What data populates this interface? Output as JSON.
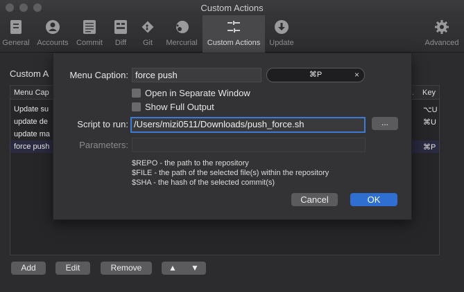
{
  "window": {
    "title": "Custom Actions"
  },
  "toolbar": {
    "items": [
      {
        "label": "General"
      },
      {
        "label": "Accounts"
      },
      {
        "label": "Commit"
      },
      {
        "label": "Diff"
      },
      {
        "label": "Git"
      },
      {
        "label": "Mercurial"
      },
      {
        "label": "Custom Actions"
      },
      {
        "label": "Update"
      },
      {
        "label": "Advanced"
      }
    ]
  },
  "main": {
    "section_title": "Custom A",
    "table": {
      "col_caption": "Menu Cap",
      "col_dots": "..",
      "col_key": "Key",
      "rows": [
        {
          "caption": "Update su",
          "key": "⌥U"
        },
        {
          "caption": "update de",
          "key": "⌘U"
        },
        {
          "caption": "update ma",
          "key": ""
        },
        {
          "caption": "force push",
          "key": "⌘P"
        }
      ]
    },
    "buttons": {
      "add": "Add",
      "edit": "Edit",
      "remove": "Remove",
      "up": "▲",
      "down": "▼"
    }
  },
  "sheet": {
    "menu_caption_label": "Menu Caption:",
    "menu_caption_value": "force push",
    "shortcut": "⌘P",
    "shortcut_clear": "×",
    "open_separate": "Open in Separate Window",
    "show_full_output": "Show Full Output",
    "script_label": "Script to run:",
    "script_value": "/Users/mizi0511/Downloads/push_force.sh",
    "browse": "...",
    "parameters_label": "Parameters:",
    "parameters_value": "",
    "help": [
      "$REPO - the path to the repository",
      "$FILE - the path of the selected file(s) within the repository",
      "$SHA - the hash of the selected commit(s)"
    ],
    "cancel": "Cancel",
    "ok": "OK"
  }
}
